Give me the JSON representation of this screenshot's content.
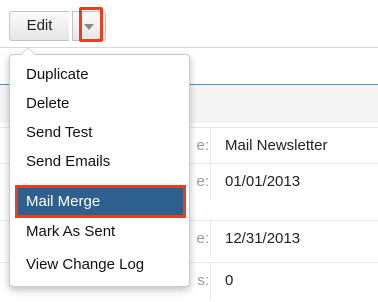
{
  "toolbar": {
    "edit_label": "Edit",
    "dropdown_icon": "caret-down-icon",
    "highlight_color": "#e8401c"
  },
  "menu": {
    "items": [
      {
        "label": "Duplicate"
      },
      {
        "label": "Delete"
      },
      {
        "label": "Send Test"
      },
      {
        "label": "Send Emails"
      },
      {
        "label": "Mail Merge",
        "active": true
      },
      {
        "label": "Mark As Sent"
      },
      {
        "label": "View Change Log"
      }
    ],
    "active_bg": "#2d5f8f"
  },
  "record": {
    "rows": [
      {
        "label_fragment": "e:",
        "value": "Mail Newsletter"
      },
      {
        "label_fragment": "e:",
        "value": "01/01/2013"
      },
      {
        "label_fragment": "e:",
        "value": "12/31/2013"
      },
      {
        "label_fragment": "s:",
        "value": "0"
      }
    ]
  }
}
